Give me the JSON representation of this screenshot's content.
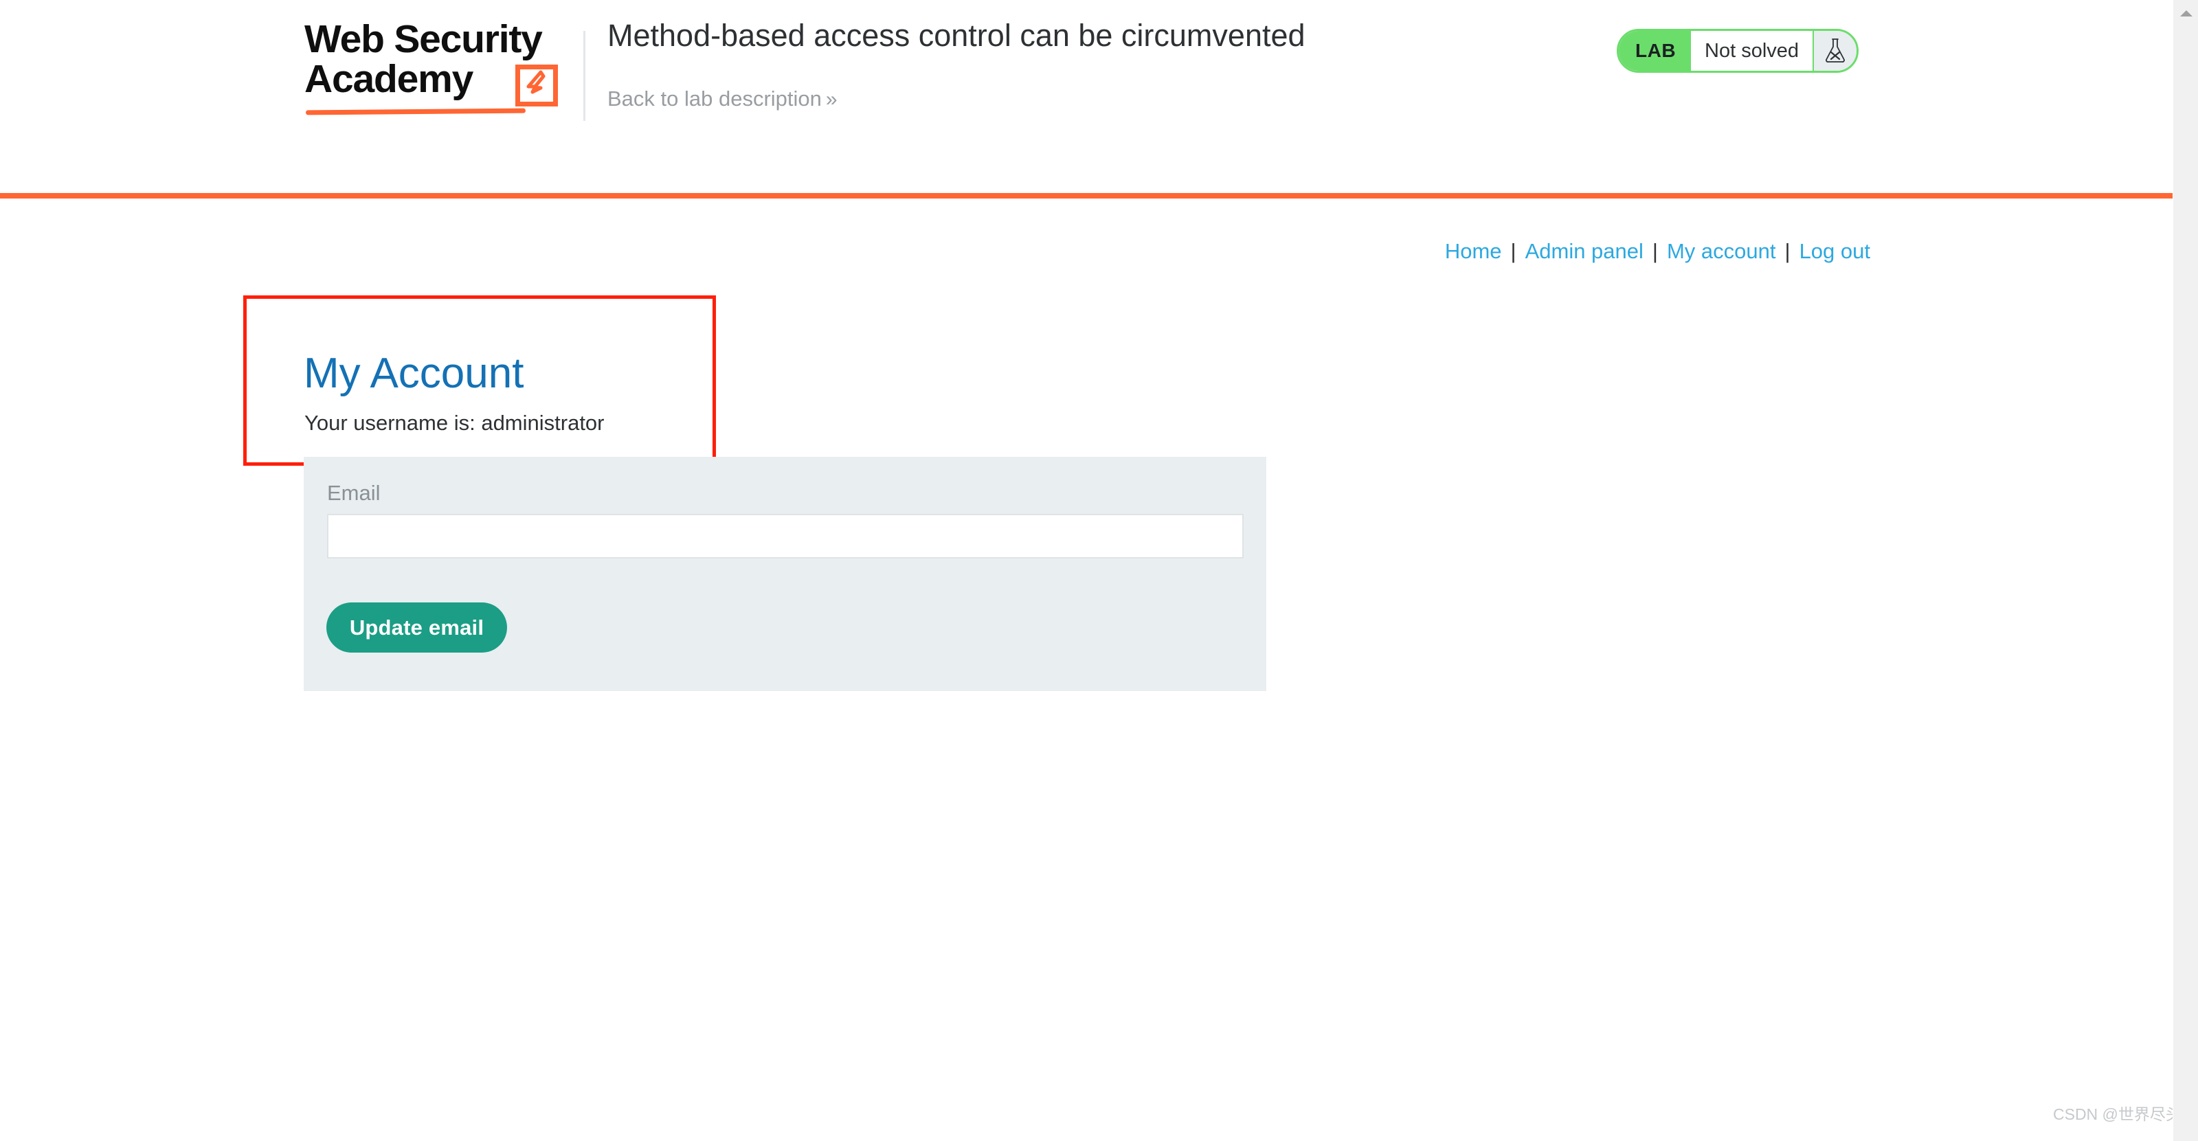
{
  "academy_header": {
    "logo": {
      "line1": "Web Security",
      "line2": "Academy",
      "badge_icon": "lightning-bolt-icon"
    },
    "lab_title": "Method-based access control can be circumvented",
    "back_link": {
      "label": "Back to lab description",
      "chevrons": "»"
    },
    "status": {
      "tag": "LAB",
      "state": "Not solved",
      "flask_icon": "flask-not-solved-icon",
      "tag_color": "#6bdd6b",
      "border_color": "#6bdd6b"
    },
    "divider_color": "#ff6633"
  },
  "shop_nav": {
    "items": [
      {
        "label": "Home"
      },
      {
        "label": "Admin panel"
      },
      {
        "label": "My account"
      },
      {
        "label": "Log out"
      }
    ],
    "separator": "|",
    "link_color": "#2ca8e0"
  },
  "main": {
    "heading": "My Account",
    "heading_color": "#1471b5",
    "username_line": "Your username is: administrator",
    "form": {
      "email_label": "Email",
      "email_value": "",
      "email_placeholder": "",
      "submit_label": "Update email",
      "submit_color": "#1b9e85",
      "panel_color": "#e9eef1"
    }
  },
  "annotation": {
    "shape": "rectangle",
    "color": "#ff1f0a"
  },
  "watermark": {
    "text": "CSDN @世界尽头与你"
  },
  "scrollbar": {
    "up_arrow_icon": "caret-up-icon"
  }
}
